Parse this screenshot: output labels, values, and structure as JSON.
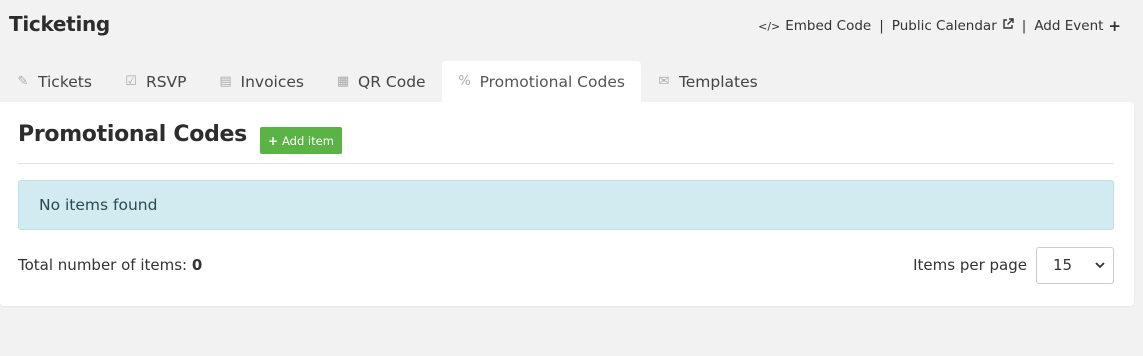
{
  "app": {
    "title": "Ticketing"
  },
  "top_actions": {
    "embed_icon": "</>",
    "embed_label": "Embed Code",
    "separator": "|",
    "calendar_label": "Public Calendar",
    "calendar_icon": "external-link-icon",
    "add_event_label": "Add Event",
    "add_event_icon": "+"
  },
  "tabs": [
    {
      "label": "Tickets",
      "icon": "ticket-icon",
      "glyph": "✎",
      "active": false
    },
    {
      "label": "RSVP",
      "icon": "checkbox-icon",
      "glyph": "☑",
      "active": false
    },
    {
      "label": "Invoices",
      "icon": "document-icon",
      "glyph": "▤",
      "active": false
    },
    {
      "label": "QR Code",
      "icon": "qr-code-icon",
      "glyph": "▦",
      "active": false
    },
    {
      "label": "Promotional Codes",
      "icon": "percent-icon",
      "glyph": "%",
      "active": true
    },
    {
      "label": "Templates",
      "icon": "envelope-icon",
      "glyph": "✉",
      "active": false
    }
  ],
  "panel": {
    "title": "Promotional Codes",
    "add_button_label": "Add item",
    "empty_message": "No items found",
    "total_label": "Total number of items:",
    "total_value": "0",
    "per_page_label": "Items per page",
    "per_page_value": "15"
  },
  "colors": {
    "accent_green": "#5cb345",
    "info_bg": "#d1ebf0",
    "page_bg": "#f2f2f2"
  }
}
